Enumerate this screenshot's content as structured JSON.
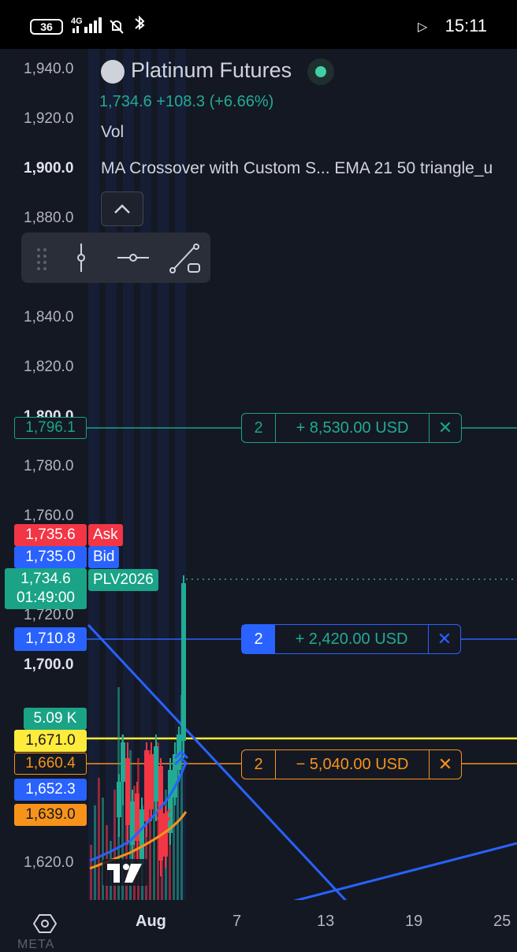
{
  "status": {
    "battery": "36",
    "network": "4G",
    "time": "15:11"
  },
  "legend": {
    "symbol": "Platinum Futures",
    "price_line": "1,734.6  +108.3 (+6.66%)",
    "vol_label": "Vol",
    "indicator": "MA Crossover with Custom S...  EMA 21 50 triangle_u"
  },
  "y_axis": {
    "ticks": [
      "1,940.0",
      "1,920.0",
      "1,900.0",
      "1,880.0",
      "1,840.0",
      "1,820.0",
      "1,800.0",
      "1,780.0",
      "1,760.0",
      "1,720.0",
      "1,700.0",
      "1,620.0"
    ],
    "bold_ticks": [
      "1,900.0",
      "1,700.0"
    ]
  },
  "price_labels": {
    "target": "1,796.1",
    "ask": "1,735.6",
    "ask_tag": "Ask",
    "bid": "1,735.0",
    "bid_tag": "Bid",
    "last": "1,734.6",
    "countdown": "01:49:00",
    "contract_tag": "PLV2026",
    "blue_line": "1,710.8",
    "volume": "5.09 K",
    "yellow_line": "1,671.0",
    "entry": "1,660.4",
    "ema21": "1,652.3",
    "ema50": "1,639.0"
  },
  "orders": [
    {
      "qty": "2",
      "pnl": "+ 8,530.00 USD",
      "close": "✕",
      "color": "#1aa386"
    },
    {
      "qty": "2",
      "pnl": "+ 2,420.00 USD",
      "close": "✕",
      "color": "#2962ff"
    },
    {
      "qty": "2",
      "pnl": "− 5,040.00 USD",
      "close": "✕",
      "color": "#f7931a"
    }
  ],
  "x_axis": {
    "ticks": [
      "Aug",
      "7",
      "13",
      "19",
      "25"
    ]
  },
  "bottom_peek": "META",
  "colors": {
    "background": "#141823",
    "up": "#22ab94",
    "down": "#f23645",
    "blue": "#2962ff",
    "yellow": "#ffeb3b",
    "orange": "#f7931a"
  }
}
